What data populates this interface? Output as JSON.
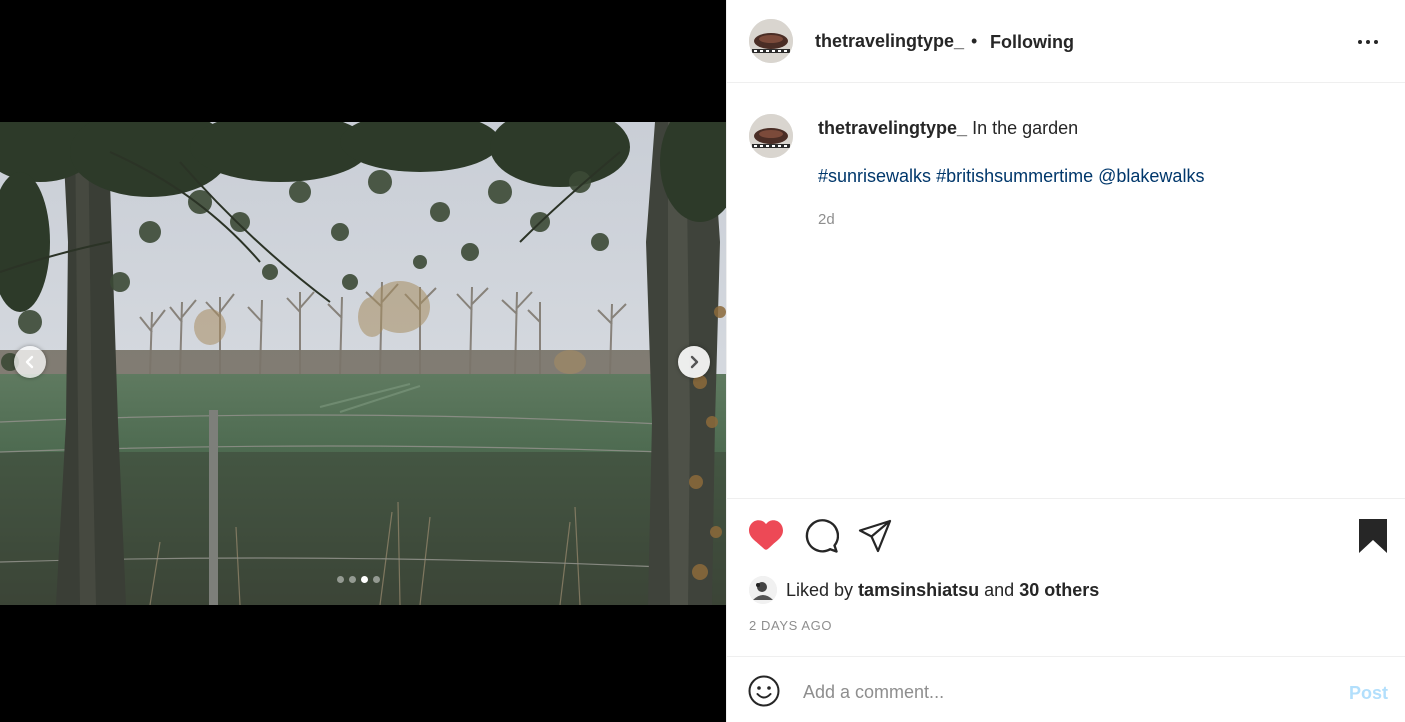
{
  "post": {
    "username": "thetravelingtype_",
    "separator": "•",
    "follow_status": "Following",
    "more_icon": "more-options-icon"
  },
  "caption": {
    "username": "thetravelingtype_",
    "text": "In the garden",
    "hashtags": [
      "#sunrisewalks",
      "#britishsummertime",
      "@blakewalks"
    ],
    "age": "2d"
  },
  "carousel": {
    "slide_count": 4,
    "active_index": 2,
    "prev_icon": "chevron-left-icon",
    "next_icon": "chevron-right-icon"
  },
  "actions": {
    "liked": true,
    "like_color": "#ed4956",
    "saved": true
  },
  "likes": {
    "prefix": "Liked by",
    "user": "tamsinshiatsu",
    "joiner": "and",
    "others": "30 others"
  },
  "date": "2 DAYS AGO",
  "comment": {
    "placeholder": "Add a comment...",
    "post_label": "Post",
    "post_color": "#b2dffc"
  }
}
